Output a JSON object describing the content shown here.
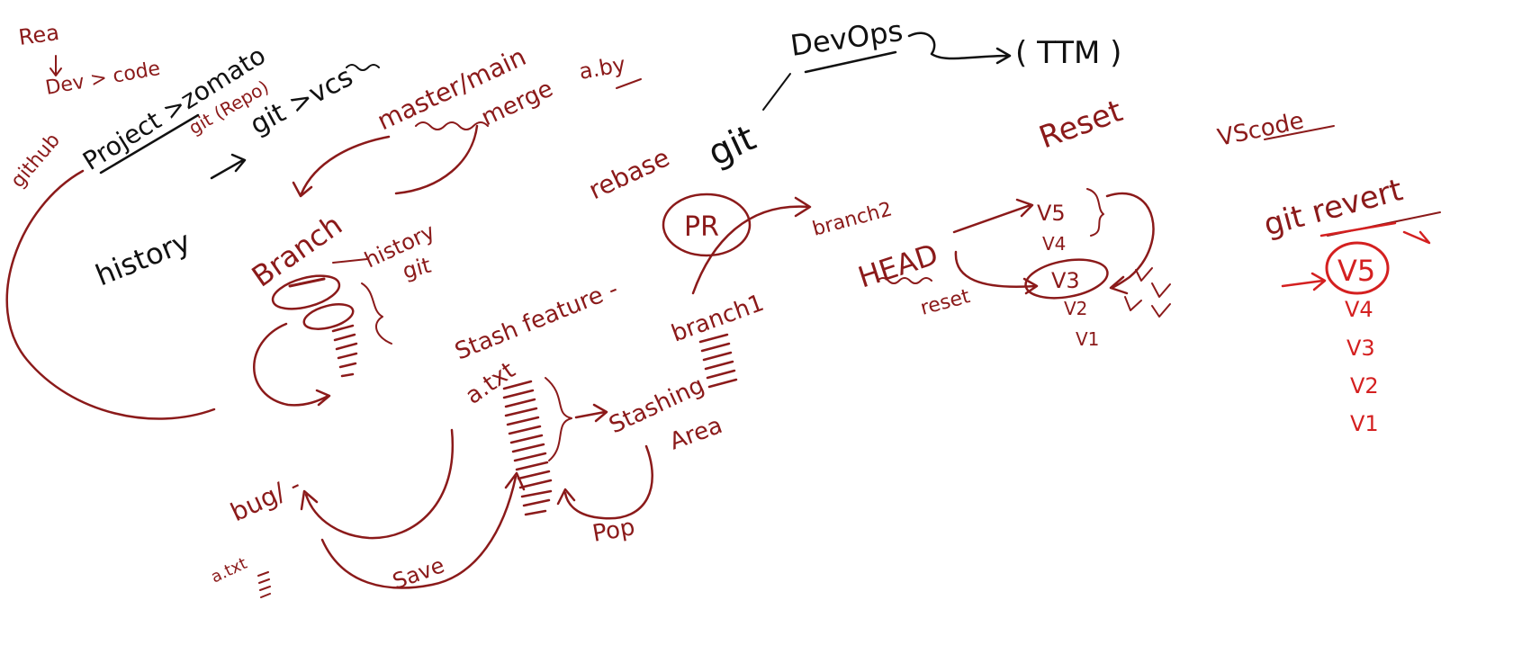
{
  "colors": {
    "maroon": "#8b1a1a",
    "black": "#111111",
    "red": "#d42020"
  },
  "notes": {
    "req": "Rea",
    "dev_code": "Dev > code",
    "project": "Project >zomato",
    "git_repo": "git (Repo)",
    "github": "github",
    "history": "history",
    "git_vcs": "git >vcs",
    "master_main": "master/main",
    "merge": "merge",
    "aby": "a.by",
    "devops": "DevOps",
    "ttm": "( TTM )",
    "rebase": "rebase",
    "git": "git",
    "reset": "Reset",
    "vscode": "VScode",
    "git_revert": "git revert",
    "branch": "Branch",
    "history_git_1": "history",
    "history_git_2": "git",
    "pr": "PR",
    "branch2": "branch2",
    "branch1": "branch1",
    "head": "HEAD",
    "reset_small": "reset",
    "v5": "V5",
    "v4": "V4",
    "v3": "V3",
    "v2": "V2",
    "v1": "V1",
    "stash_feature": "Stash feature -",
    "atxt": "a.txt",
    "stashing_area_1": "Stashing",
    "stashing_area_2": "Area",
    "pop": "Pop",
    "bug": "bug/ -",
    "atxt_small": "a.txt",
    "save": "Save",
    "rv5": "V5",
    "rv4": "V4",
    "rv3": "V3",
    "rv2": "V2",
    "rv1": "V1"
  }
}
